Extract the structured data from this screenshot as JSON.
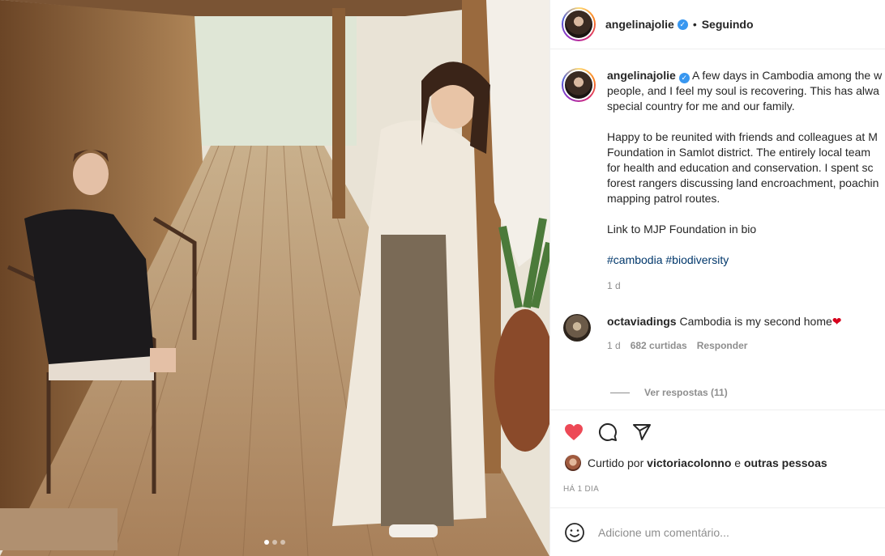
{
  "post": {
    "image_alt": "Angelina Jolie on a wooden veranda in Cambodia",
    "carousel": {
      "total": 3,
      "active": 1
    }
  },
  "header": {
    "username": "angelinajolie",
    "verified_icon": "verified-badge-icon",
    "separator": "•",
    "follow_label": "Seguindo"
  },
  "caption": {
    "username": "angelinajolie",
    "paragraph1": "A few days in Cambodia among the warm people, and I feel my soul is recovering. This has always been a special country for me and our family.",
    "paragraph1_lines": [
      "A few days in Cambodia among the w",
      "people, and I feel my soul is recovering. This has alwa",
      "special country for me and our family."
    ],
    "paragraph2_lines": [
      "Happy to be reunited with friends and colleagues at M",
      "Foundation in Samlot district. The entirely local team",
      "for health and education and conservation. I spent sc",
      "forest rangers discussing land encroachment, poachin",
      "mapping patrol routes."
    ],
    "paragraph3": "Link to MJP Foundation in bio",
    "hashtags": [
      "#cambodia",
      "#biodiversity"
    ],
    "time": "1 d"
  },
  "comment": {
    "username": "octaviadings",
    "text": "Cambodia is my second home",
    "emoji": "❤",
    "time": "1 d",
    "likes": "682 curtidas",
    "reply_label": "Responder",
    "view_replies": "Ver respostas (11)"
  },
  "actions": {
    "like_icon": "heart-filled-icon",
    "comment_icon": "comment-icon",
    "share_icon": "share-icon",
    "like_color": "#ed4956"
  },
  "likes": {
    "prefix": "Curtido por",
    "user": "victoriacolonno",
    "connector": "e",
    "others": "outras pessoas"
  },
  "timestamp": "HÁ 1 DIA",
  "add_comment": {
    "emoji_icon": "emoji-smile-icon",
    "placeholder": "Adicione um comentário..."
  }
}
